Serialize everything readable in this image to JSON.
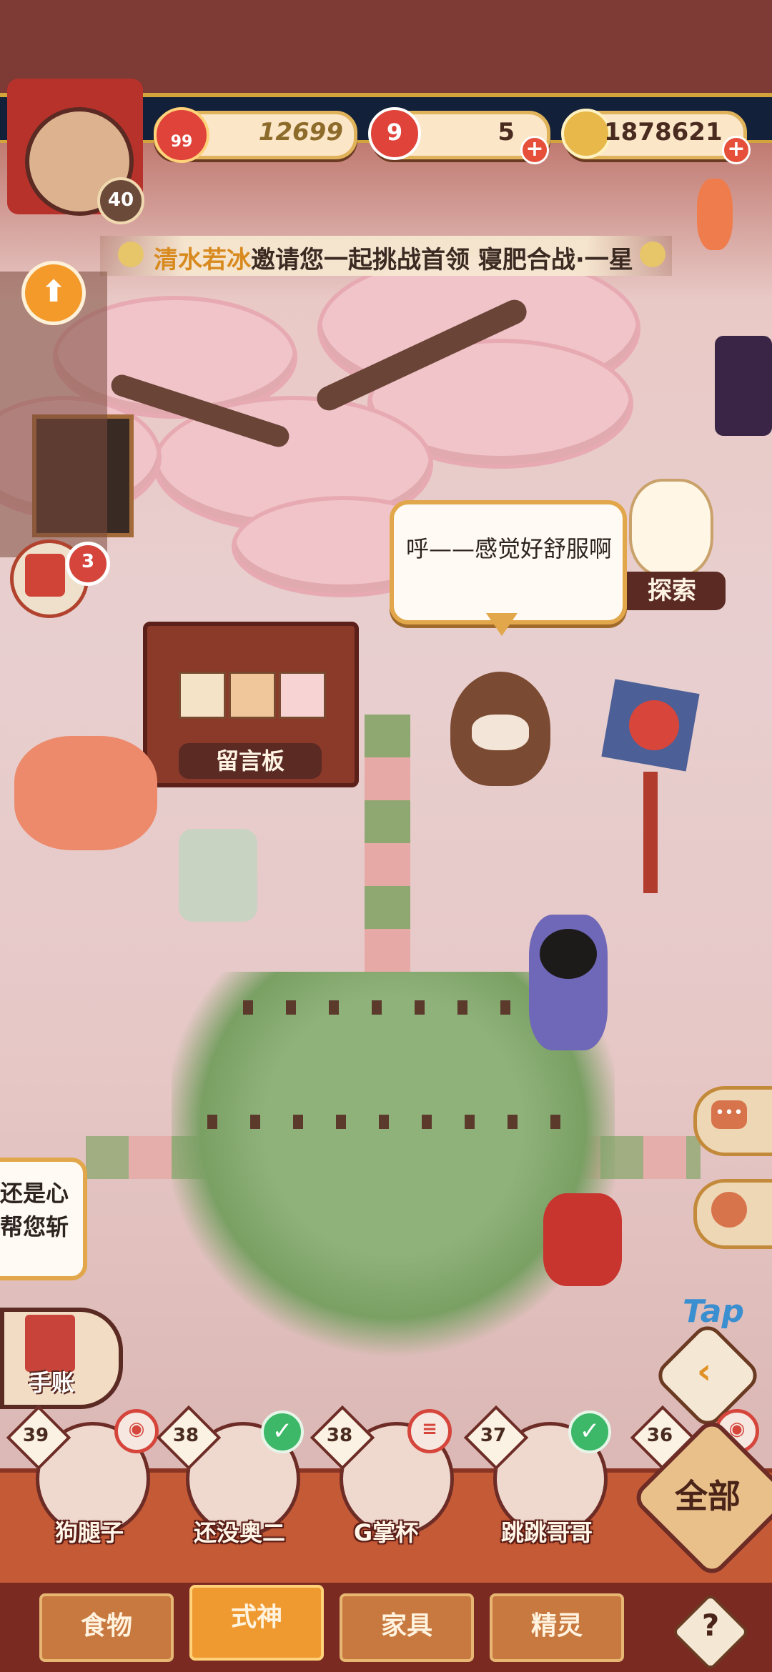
{
  "hud": {
    "player_level": "40",
    "jade_amount": "12699",
    "jade_badge": "99",
    "tickets": "5",
    "ticket_badge": "9",
    "coins": "1878621"
  },
  "banner": {
    "inviter": "清水若冰",
    "message": "邀请您一起挑战首领 寝肥合战·一星"
  },
  "notifications": {
    "mail_count": "3"
  },
  "bubble": {
    "text": "呼——感觉好舒服啊"
  },
  "scene": {
    "board_label": "留言板",
    "explore_label": "探索",
    "left_bubble_text_1": "还是心",
    "left_bubble_text_2": "帮您斩",
    "journal_label": "手账",
    "tap_label": "Tap"
  },
  "characters": [
    {
      "level": "39",
      "name": "狗腿子",
      "status": "red"
    },
    {
      "level": "38",
      "name": "还没奥二",
      "status": "check"
    },
    {
      "level": "38",
      "name": "G掌杯",
      "status": "red"
    },
    {
      "level": "37",
      "name": "跳跳哥哥",
      "status": "check"
    },
    {
      "level": "36",
      "name": "",
      "status": "red"
    }
  ],
  "all_button": "全部",
  "tabs": [
    {
      "label": "食物"
    },
    {
      "label": "式神"
    },
    {
      "label": "家具"
    },
    {
      "label": "精灵"
    }
  ],
  "help_label": "?",
  "colors": {
    "accent": "#e0b25a",
    "tab_active": "#ef9a31",
    "brand_dark": "#7b2a22"
  }
}
